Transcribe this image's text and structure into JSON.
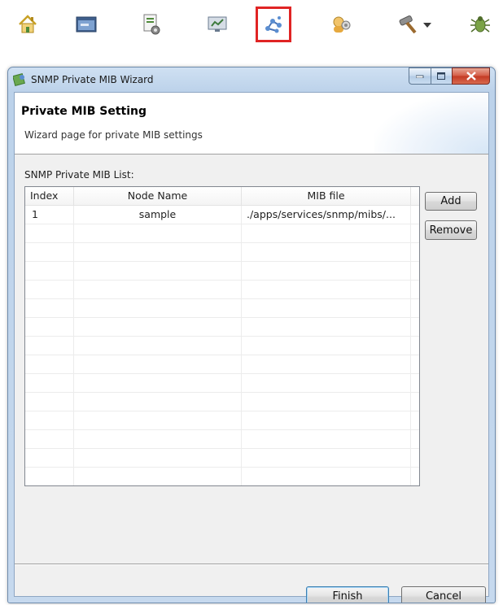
{
  "toolbar": {
    "icons": [
      {
        "name": "home-icon"
      },
      {
        "name": "terminal-icon"
      },
      {
        "name": "document-settings-icon"
      },
      {
        "name": "monitor-icon"
      },
      {
        "name": "network-icon",
        "selected": true
      },
      {
        "name": "users-icon"
      },
      {
        "name": "hammer-dropdown-icon"
      },
      {
        "name": "bug-icon"
      }
    ],
    "selected_color": "#e02424"
  },
  "dialog": {
    "title": "SNMP Private MIB Wizard",
    "banner": {
      "title": "Private MIB Setting",
      "description": "Wizard page for private MIB settings"
    },
    "list_label": "SNMP Private MIB List:",
    "table": {
      "columns": [
        "Index",
        "Node Name",
        "MIB file"
      ],
      "rows": [
        {
          "index": "1",
          "node_name": "sample",
          "mib_file": "./apps/services/snmp/mibs/..."
        }
      ]
    },
    "buttons": {
      "add": "Add",
      "remove": "Remove",
      "finish": "Finish",
      "cancel": "Cancel"
    }
  }
}
